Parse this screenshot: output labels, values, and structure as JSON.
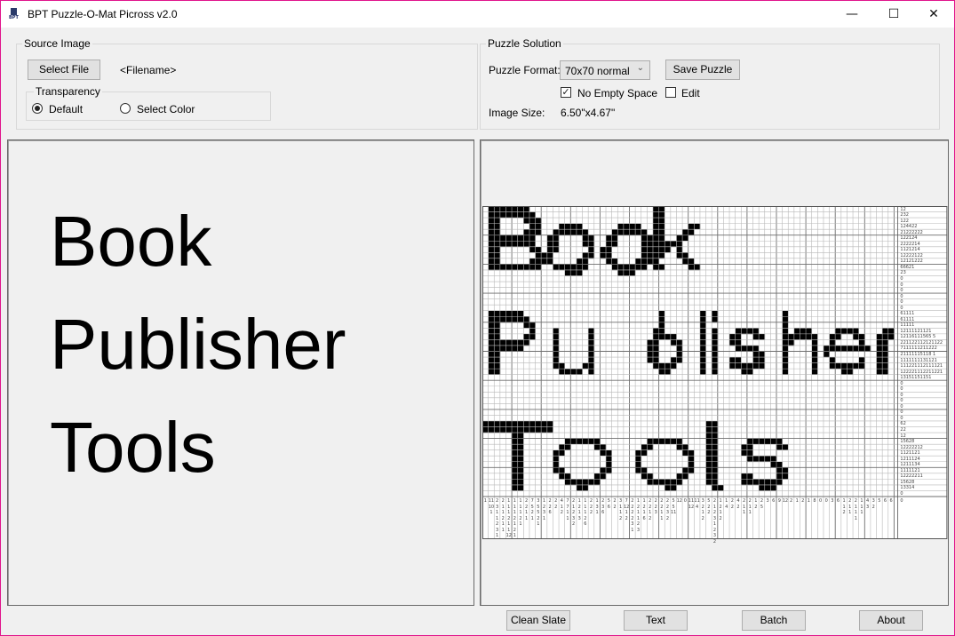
{
  "window": {
    "title": "BPT Puzzle-O-Mat Picross v2.0",
    "icon_text": "BPT",
    "minimize_glyph": "—",
    "maximize_glyph": "☐",
    "close_glyph": "✕",
    "border_color": "#e0148c"
  },
  "source_image": {
    "group_label": "Source Image",
    "select_file_label": "Select File",
    "filename": "<Filename>",
    "transparency": {
      "group_label": "Transparency",
      "options": [
        {
          "label": "Default",
          "selected": true
        },
        {
          "label": "Select Color",
          "selected": false
        }
      ]
    }
  },
  "puzzle_solution": {
    "group_label": "Puzzle Solution",
    "format_label": "Puzzle Format:",
    "format_value": "70x70 normal",
    "save_label": "Save Puzzle",
    "no_empty_space_label": "No Empty Space",
    "no_empty_space_checked": true,
    "edit_label": "Edit",
    "edit_checked": false,
    "image_size_label": "Image Size:",
    "image_size_value": "6.50\"x4.67\""
  },
  "preview": {
    "lines": [
      "Book",
      "Publisher",
      "Tools"
    ]
  },
  "puzzle": {
    "columns": 70,
    "rows": 50,
    "row_clues": [
      "12",
      "232",
      "122",
      "124422",
      "21222222",
      "122124",
      "2222214",
      "1121214",
      "12222122",
      "12121222",
      "66621",
      "23",
      "0",
      "0",
      "0",
      "0",
      "0",
      "0",
      "61111",
      "61111",
      "11111",
      "12111121121",
      "12116111565 5",
      "221122112121122",
      "7111111211222",
      "21111115118 1",
      "1111111131121",
      "111221112111121",
      "122221112211221",
      "13151151151",
      "0",
      "0",
      "0",
      "0",
      "0",
      "0",
      "0",
      "62",
      "22",
      "12",
      "15628",
      "12222212",
      "1121121",
      "1211124",
      "1211134",
      "1111121",
      "12222211",
      "15628",
      "13314",
      "0"
    ],
    "col_clues": [
      [
        "1"
      ],
      [
        "11",
        "10",
        "1"
      ],
      [
        "2",
        "3",
        "1",
        "1",
        "2",
        "3",
        "1"
      ],
      [
        "2",
        "1",
        "1",
        "2",
        "1",
        "1"
      ],
      [
        "1",
        "1",
        "1",
        "2",
        "1",
        "1",
        "12"
      ],
      [
        "1",
        "1",
        "1",
        "2",
        "1",
        "2",
        "1"
      ],
      [
        "1",
        "1",
        "1",
        "2",
        "1"
      ],
      [
        "2",
        "2",
        "1",
        "1"
      ],
      [
        "7",
        "5",
        "2",
        "1"
      ],
      [
        "3",
        "5",
        "5",
        "2",
        "1"
      ],
      [
        "1",
        "2",
        "3",
        "1"
      ],
      [
        "2",
        "2",
        "6"
      ],
      [
        "2",
        "2"
      ],
      [
        "4",
        "1",
        "2"
      ],
      [
        "7",
        "7",
        "1",
        "1"
      ],
      [
        "2",
        "1",
        "2",
        "3",
        "2"
      ],
      [
        "1",
        "2",
        "1",
        "3"
      ],
      [
        "1",
        "1",
        "1",
        "2",
        "6"
      ],
      [
        "2",
        "2",
        "2"
      ],
      [
        "1",
        "3",
        "1"
      ],
      [
        "2",
        "3",
        "6"
      ],
      [
        "5",
        "6"
      ],
      [
        "2",
        "2"
      ],
      [
        "3",
        "1",
        "1",
        "2"
      ],
      [
        "7",
        "12",
        "1",
        "2"
      ],
      [
        "2",
        "2",
        "2",
        "2",
        "3",
        "1"
      ],
      [
        "1",
        "2",
        "1",
        "1",
        "2",
        "3"
      ],
      [
        "1",
        "2",
        "1",
        "6"
      ],
      [
        "2",
        "2",
        "1",
        "2"
      ],
      [
        "2",
        "2",
        "3"
      ],
      [
        "2",
        "2",
        "1",
        "1"
      ],
      [
        "2",
        "2",
        "3",
        "2"
      ],
      [
        "5",
        "5",
        "11"
      ],
      [
        "12"
      ],
      [
        "0"
      ],
      [
        "11",
        "12"
      ],
      [
        "11",
        "4"
      ],
      [
        "3",
        "2",
        "1",
        "2"
      ],
      [
        "5",
        "2",
        "2"
      ],
      [
        "2",
        "1",
        "2",
        "3",
        "1",
        "2",
        "3",
        "2"
      ],
      [
        "1",
        "2",
        "1",
        "2"
      ],
      [
        "1",
        "4"
      ],
      [
        "2",
        "2"
      ],
      [
        "4",
        "2"
      ],
      [
        "2",
        "1",
        "1"
      ],
      [
        "2",
        "1",
        "1"
      ],
      [
        "1",
        "2"
      ],
      [
        "2",
        "5"
      ],
      [
        "3"
      ],
      [
        "6"
      ],
      [
        "9"
      ],
      [
        "12"
      ],
      [
        "2"
      ],
      [
        "1"
      ],
      [
        "2"
      ],
      [
        "1"
      ],
      [
        "8"
      ],
      [
        "0"
      ],
      [
        "0"
      ],
      [
        "3"
      ],
      [
        "6"
      ],
      [
        "1",
        "1",
        "2"
      ],
      [
        "2",
        "1",
        "1"
      ],
      [
        "2",
        "1",
        "1",
        "1"
      ],
      [
        "1",
        "1",
        "1"
      ],
      [
        "4",
        "3"
      ],
      [
        "3",
        "2"
      ],
      [
        "5"
      ],
      [
        "6"
      ],
      [
        "6"
      ]
    ],
    "extra_clue": "0",
    "cell_fill": "#000000",
    "cell_empty": "#ffffff",
    "grid_line": "#b8b8b8",
    "grid_line_major": "#6e6e6e",
    "bitmap": [
      ".XXXXXXX.....................XX.......................................",
      ".XXXXXXXX....................XX.......................................",
      ".XX....XXX...................XX.......................................",
      ".XX.....XX...XXXX......XXXX..XX....XX.................................",
      ".XX....XXX..XXXXXX....XXXXXX.XX...XX..................................",
      ".XXXXXXXX..XX....XX..XX....XXXX..XX...................................",
      ".XXXXXXXX..XX....XX..XX....XXXXXXX....................................",
      ".XX.....XX.XX.....X.XX.....XXXXX.X....................................",
      ".XX......XXX.....XX.XX.....XXXX..XX...................................",
      ".XX.....XXXX....XX...XX...XXXX....XX..................................",
      ".XXXXXXXXX..XXXXXX....XXXXXX.XX....XX.................................",
      "..............XXX......XXX............................................",
      "......................................................................",
      "......................................................................",
      "......................................................................",
      "......................................................................",
      "......................................................................",
      "......................................................................",
      ".XXXXXX.......................X......X.X...........X..................",
      ".XXXXXXX......................X......X.X...........X..................",
      ".XX....XX.....................X......X.............X..................",
      ".XX.....X...X.....X..........XX......X.X...XXXX....X.XXX....XXXX....XX",
      ".XX....XX...X.....X..........XXXX....X.X..XX..XX...XXXXXX..XX..XX..XXX",
      ".XXXXXXX....X.....X.........XX..XX...X.X..XX.......XX...X..X....X..XX.",
      ".XXXXXX.....X.....X.........XX...X...X.X...XXXX....X....X.XXXXXXXX.XX.",
      ".XX.........X.....X.........XX...X...X.X......XX...X....X.X........XX.",
      ".XX.........X.....X.........XX..XX...X.X..XX..XX...X....X..X....X..XX.",
      ".XX.........XX...XX..........XXXX....X.X..XXXXXX...X....X..XXXXXX..XX.",
      ".XX..........XXXX.X...........XX.....X.X....XX.....X....X....XX....XX.",
      "......................................................................",
      "......................................................................",
      "......................................................................",
      "......................................................................",
      "......................................................................",
      "......................................................................",
      "......................................................................",
      "......................................................................",
      "XXXXXXXXXXXX..........................XX..............................",
      "XXXXXXXXXXXX..........................XX..............................",
      ".....XX...............................XX..............................",
      ".....XX.......XXXXXX........XXXXXX....XX.....XXXXXX...................",
      ".....XX......XX....XX......XX....XX...XX....XX....XX..................",
      ".....XX.....XX......XX....XX......XX..XX....XX........................",
      ".....XX.....X........X....X........X..XX.....XXXXX....................",
      ".....XX.....X........X....X........X..XX.........XX...................",
      ".....XX.....XX......XX....XX......XX..XX..........XX..................",
      ".....XX......XX....XX......XX....XX...XX....XX....XX..................",
      ".....XX.......XXXXXX........XXXXXX....XX....XXXXXXX...................",
      ".....XX.........XX.............XX......XX......XXX....................",
      "......................................................................"
    ]
  },
  "bottom_buttons": [
    {
      "label": "Clean Slate"
    },
    {
      "label": "Text"
    },
    {
      "label": "Batch"
    },
    {
      "label": "About"
    }
  ]
}
